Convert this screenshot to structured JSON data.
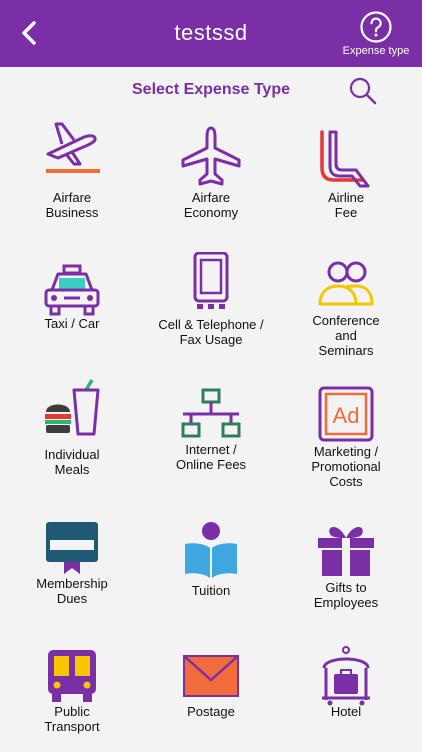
{
  "header": {
    "title": "testssd",
    "expense_type_label": "Expense type"
  },
  "main": {
    "heading": "Select Expense Type",
    "items": [
      {
        "line1": "Airfare",
        "line2": "Business",
        "line3": ""
      },
      {
        "line1": "Airfare",
        "line2": "Economy",
        "line3": ""
      },
      {
        "line1": "Airline",
        "line2": "Fee",
        "line3": ""
      },
      {
        "line1": "Taxi / Car",
        "line2": "",
        "line3": ""
      },
      {
        "line1": "Cell & Telephone /",
        "line2": "Fax Usage",
        "line3": ""
      },
      {
        "line1": "Conference",
        "line2": "and",
        "line3": "Seminars"
      },
      {
        "line1": "Individual",
        "line2": "Meals",
        "line3": ""
      },
      {
        "line1": "Internet /",
        "line2": "Online Fees",
        "line3": ""
      },
      {
        "line1": "Marketing /",
        "line2": "Promotional",
        "line3": "Costs"
      },
      {
        "line1": "Membership",
        "line2": "Dues",
        "line3": ""
      },
      {
        "line1": "Tuition",
        "line2": "",
        "line3": ""
      },
      {
        "line1": "Gifts to",
        "line2": "Employees",
        "line3": ""
      },
      {
        "line1": "Public",
        "line2": "Transport",
        "line3": ""
      },
      {
        "line1": "Postage",
        "line2": "",
        "line3": ""
      },
      {
        "line1": "Hotel",
        "line2": "",
        "line3": ""
      }
    ]
  },
  "icons": {
    "back": "chevron-left-icon",
    "expense_type": "question-circle-icon",
    "search": "search-icon"
  },
  "colors": {
    "header": "#7b2fa6",
    "accent": "#7b2fa6",
    "background": "#f3f3f3"
  }
}
